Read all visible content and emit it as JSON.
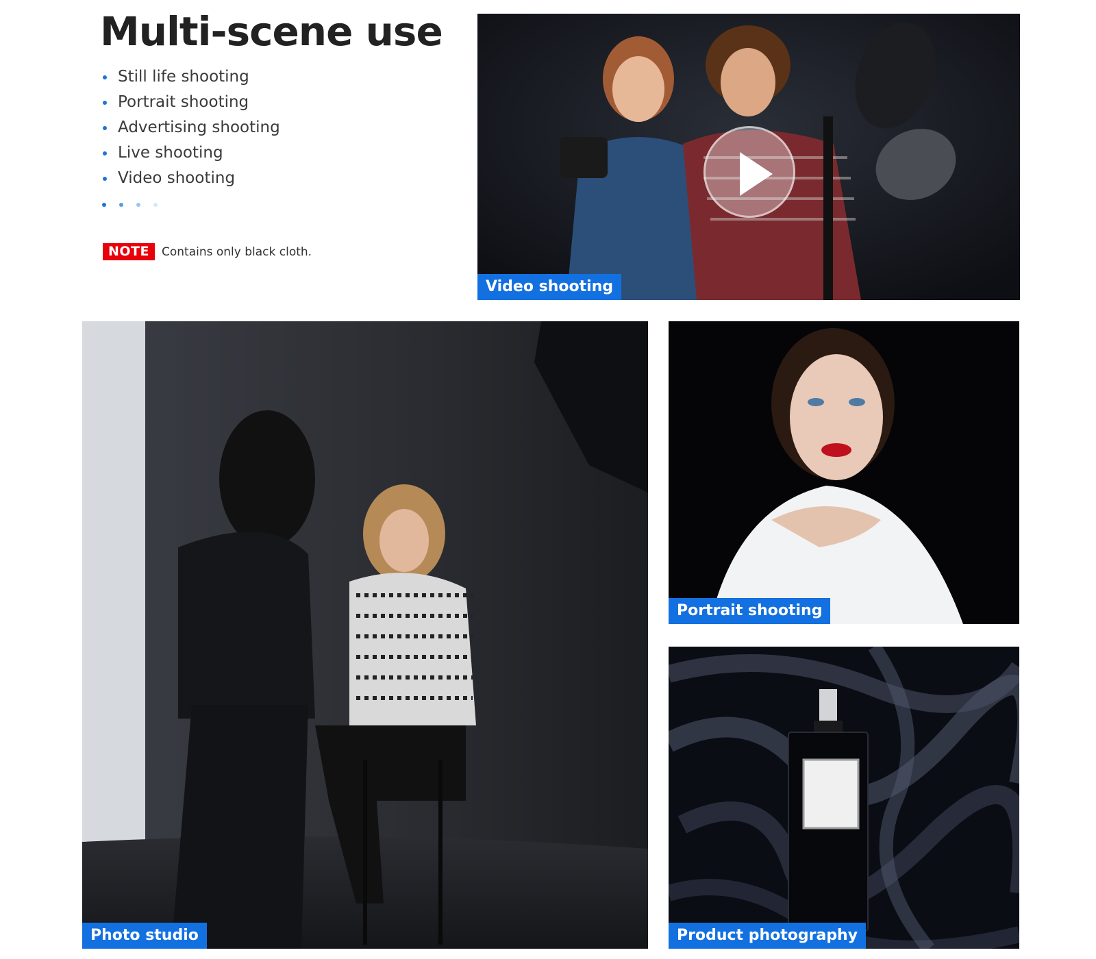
{
  "heading": "Multi-scene use",
  "bullets": [
    "Still life shooting",
    "Portrait shooting",
    "Advertising shooting",
    "Live shooting",
    "Video shooting"
  ],
  "pager": {
    "dot_colors": [
      "#1e73d8",
      "#5a9be6",
      "#9ec3ef",
      "#d6e6f8"
    ]
  },
  "note": {
    "badge": "NOTE",
    "text": "Contains only black cloth."
  },
  "photos": {
    "video": {
      "caption": "Video shooting",
      "icon": "play-icon"
    },
    "studio": {
      "caption": "Photo studio"
    },
    "portrait": {
      "caption": "Portrait shooting"
    },
    "product": {
      "caption": "Product photography"
    }
  },
  "colors": {
    "accent": "#1370e0",
    "note_red": "#e8000b"
  }
}
